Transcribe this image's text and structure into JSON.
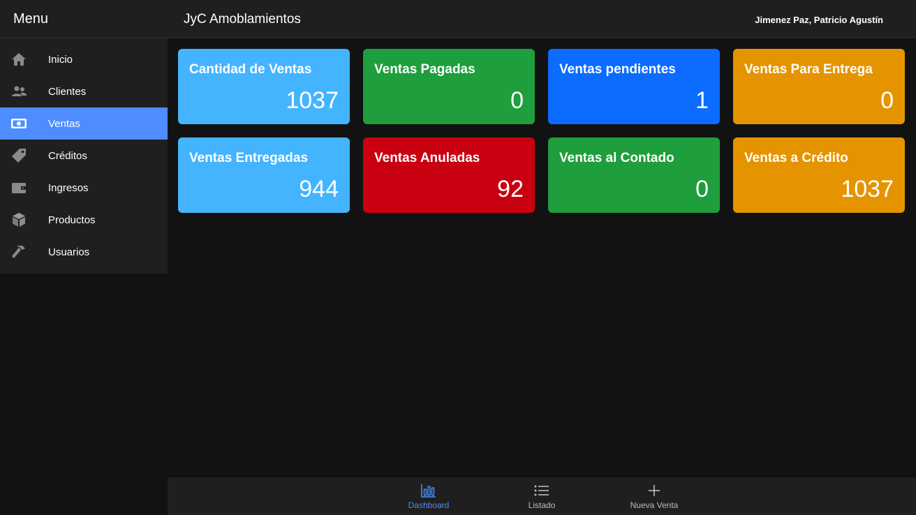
{
  "sidebar": {
    "title": "Menu",
    "items": [
      {
        "label": "Inicio",
        "icon": "home-icon"
      },
      {
        "label": "Clientes",
        "icon": "users-icon"
      },
      {
        "label": "Ventas",
        "icon": "money-icon",
        "active": true
      },
      {
        "label": "Créditos",
        "icon": "tag-icon"
      },
      {
        "label": "Ingresos",
        "icon": "wallet-icon"
      },
      {
        "label": "Productos",
        "icon": "box-icon"
      },
      {
        "label": "Usuarios",
        "icon": "hammer-icon"
      }
    ]
  },
  "header": {
    "title": "JyC Amoblamientos",
    "user": "Jimenez Paz, Patricio Agustín"
  },
  "cards": [
    {
      "title": "Cantidad de Ventas",
      "value": "1037",
      "color": "#44b4ff"
    },
    {
      "title": "Ventas Pagadas",
      "value": "0",
      "color": "#1e9e3c"
    },
    {
      "title": "Ventas pendientes",
      "value": "1",
      "color": "#0b6cff"
    },
    {
      "title": "Ventas Para Entrega",
      "value": "0",
      "color": "#e59400"
    },
    {
      "title": "Ventas Entregadas",
      "value": "944",
      "color": "#44b4ff"
    },
    {
      "title": "Ventas Anuladas",
      "value": "92",
      "color": "#c80010"
    },
    {
      "title": "Ventas al Contado",
      "value": "0",
      "color": "#1e9e3c"
    },
    {
      "title": "Ventas a Crédito",
      "value": "1037",
      "color": "#e59400"
    }
  ],
  "bottomnav": {
    "items": [
      {
        "label": "Dashboard",
        "icon": "bar-chart-icon",
        "active": true
      },
      {
        "label": "Listado",
        "icon": "list-icon"
      },
      {
        "label": "Nueva Venta",
        "icon": "plus-icon"
      }
    ]
  },
  "colors": {
    "accent": "#4d8dff",
    "background": "#121212",
    "panel": "#1f1f1f"
  }
}
